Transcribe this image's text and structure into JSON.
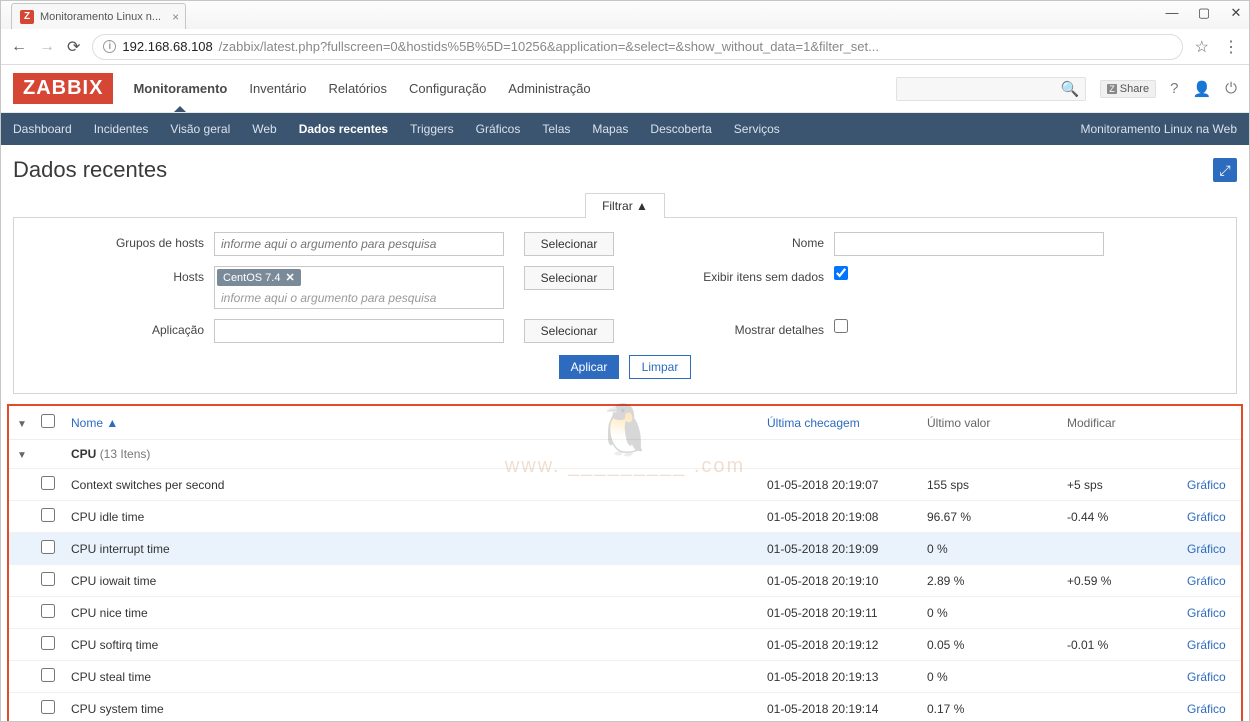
{
  "browser": {
    "tab_title": "Monitoramento Linux n...",
    "tab_favicon": "Z",
    "url_origin": "192.168.68.108",
    "url_path": "/zabbix/latest.php?fullscreen=0&hostids%5B%5D=10256&application=&select=&show_without_data=1&filter_set..."
  },
  "header": {
    "logo": "ZABBIX",
    "menu": [
      "Monitoramento",
      "Inventário",
      "Relatórios",
      "Configuração",
      "Administração"
    ],
    "share_label": "Share",
    "search_icon": "🔍"
  },
  "subnav": {
    "items": [
      "Dashboard",
      "Incidentes",
      "Visão geral",
      "Web",
      "Dados recentes",
      "Triggers",
      "Gráficos",
      "Telas",
      "Mapas",
      "Descoberta",
      "Serviços"
    ],
    "right_label": "Monitoramento Linux na Web"
  },
  "page_title": "Dados recentes",
  "filter": {
    "tab_label": "Filtrar ▲",
    "groups_label": "Grupos de hosts",
    "groups_placeholder": "informe aqui o argumento para pesquisa",
    "hosts_label": "Hosts",
    "hosts_tag": "CentOS 7.4",
    "hosts_placeholder": "informe aqui o argumento para pesquisa",
    "application_label": "Aplicação",
    "select_btn": "Selecionar",
    "name_label": "Nome",
    "show_without_label": "Exibir itens sem dados",
    "show_details_label": "Mostrar detalhes",
    "apply_btn": "Aplicar",
    "reset_btn": "Limpar"
  },
  "watermark_text": "www. _________ .com",
  "table": {
    "headers": {
      "name": "Nome ▲",
      "last_check": "Última checagem",
      "last_value": "Último valor",
      "change": "Modificar"
    },
    "group_name": "CPU",
    "group_count": "(13 Itens)",
    "graph_label": "Gráfico",
    "rows": [
      {
        "name": "Context switches per second",
        "lc": "01-05-2018 20:19:07",
        "lv": "155 sps",
        "ch": "+5 sps",
        "hl": false
      },
      {
        "name": "CPU idle time",
        "lc": "01-05-2018 20:19:08",
        "lv": "96.67 %",
        "ch": "-0.44 %",
        "hl": false
      },
      {
        "name": "CPU interrupt time",
        "lc": "01-05-2018 20:19:09",
        "lv": "0 %",
        "ch": "",
        "hl": true
      },
      {
        "name": "CPU iowait time",
        "lc": "01-05-2018 20:19:10",
        "lv": "2.89 %",
        "ch": "+0.59 %",
        "hl": false
      },
      {
        "name": "CPU nice time",
        "lc": "01-05-2018 20:19:11",
        "lv": "0 %",
        "ch": "",
        "hl": false
      },
      {
        "name": "CPU softirq time",
        "lc": "01-05-2018 20:19:12",
        "lv": "0.05 %",
        "ch": "-0.01 %",
        "hl": false
      },
      {
        "name": "CPU steal time",
        "lc": "01-05-2018 20:19:13",
        "lv": "0 %",
        "ch": "",
        "hl": false
      },
      {
        "name": "CPU system time",
        "lc": "01-05-2018 20:19:14",
        "lv": "0.17 %",
        "ch": "",
        "hl": false
      }
    ]
  }
}
